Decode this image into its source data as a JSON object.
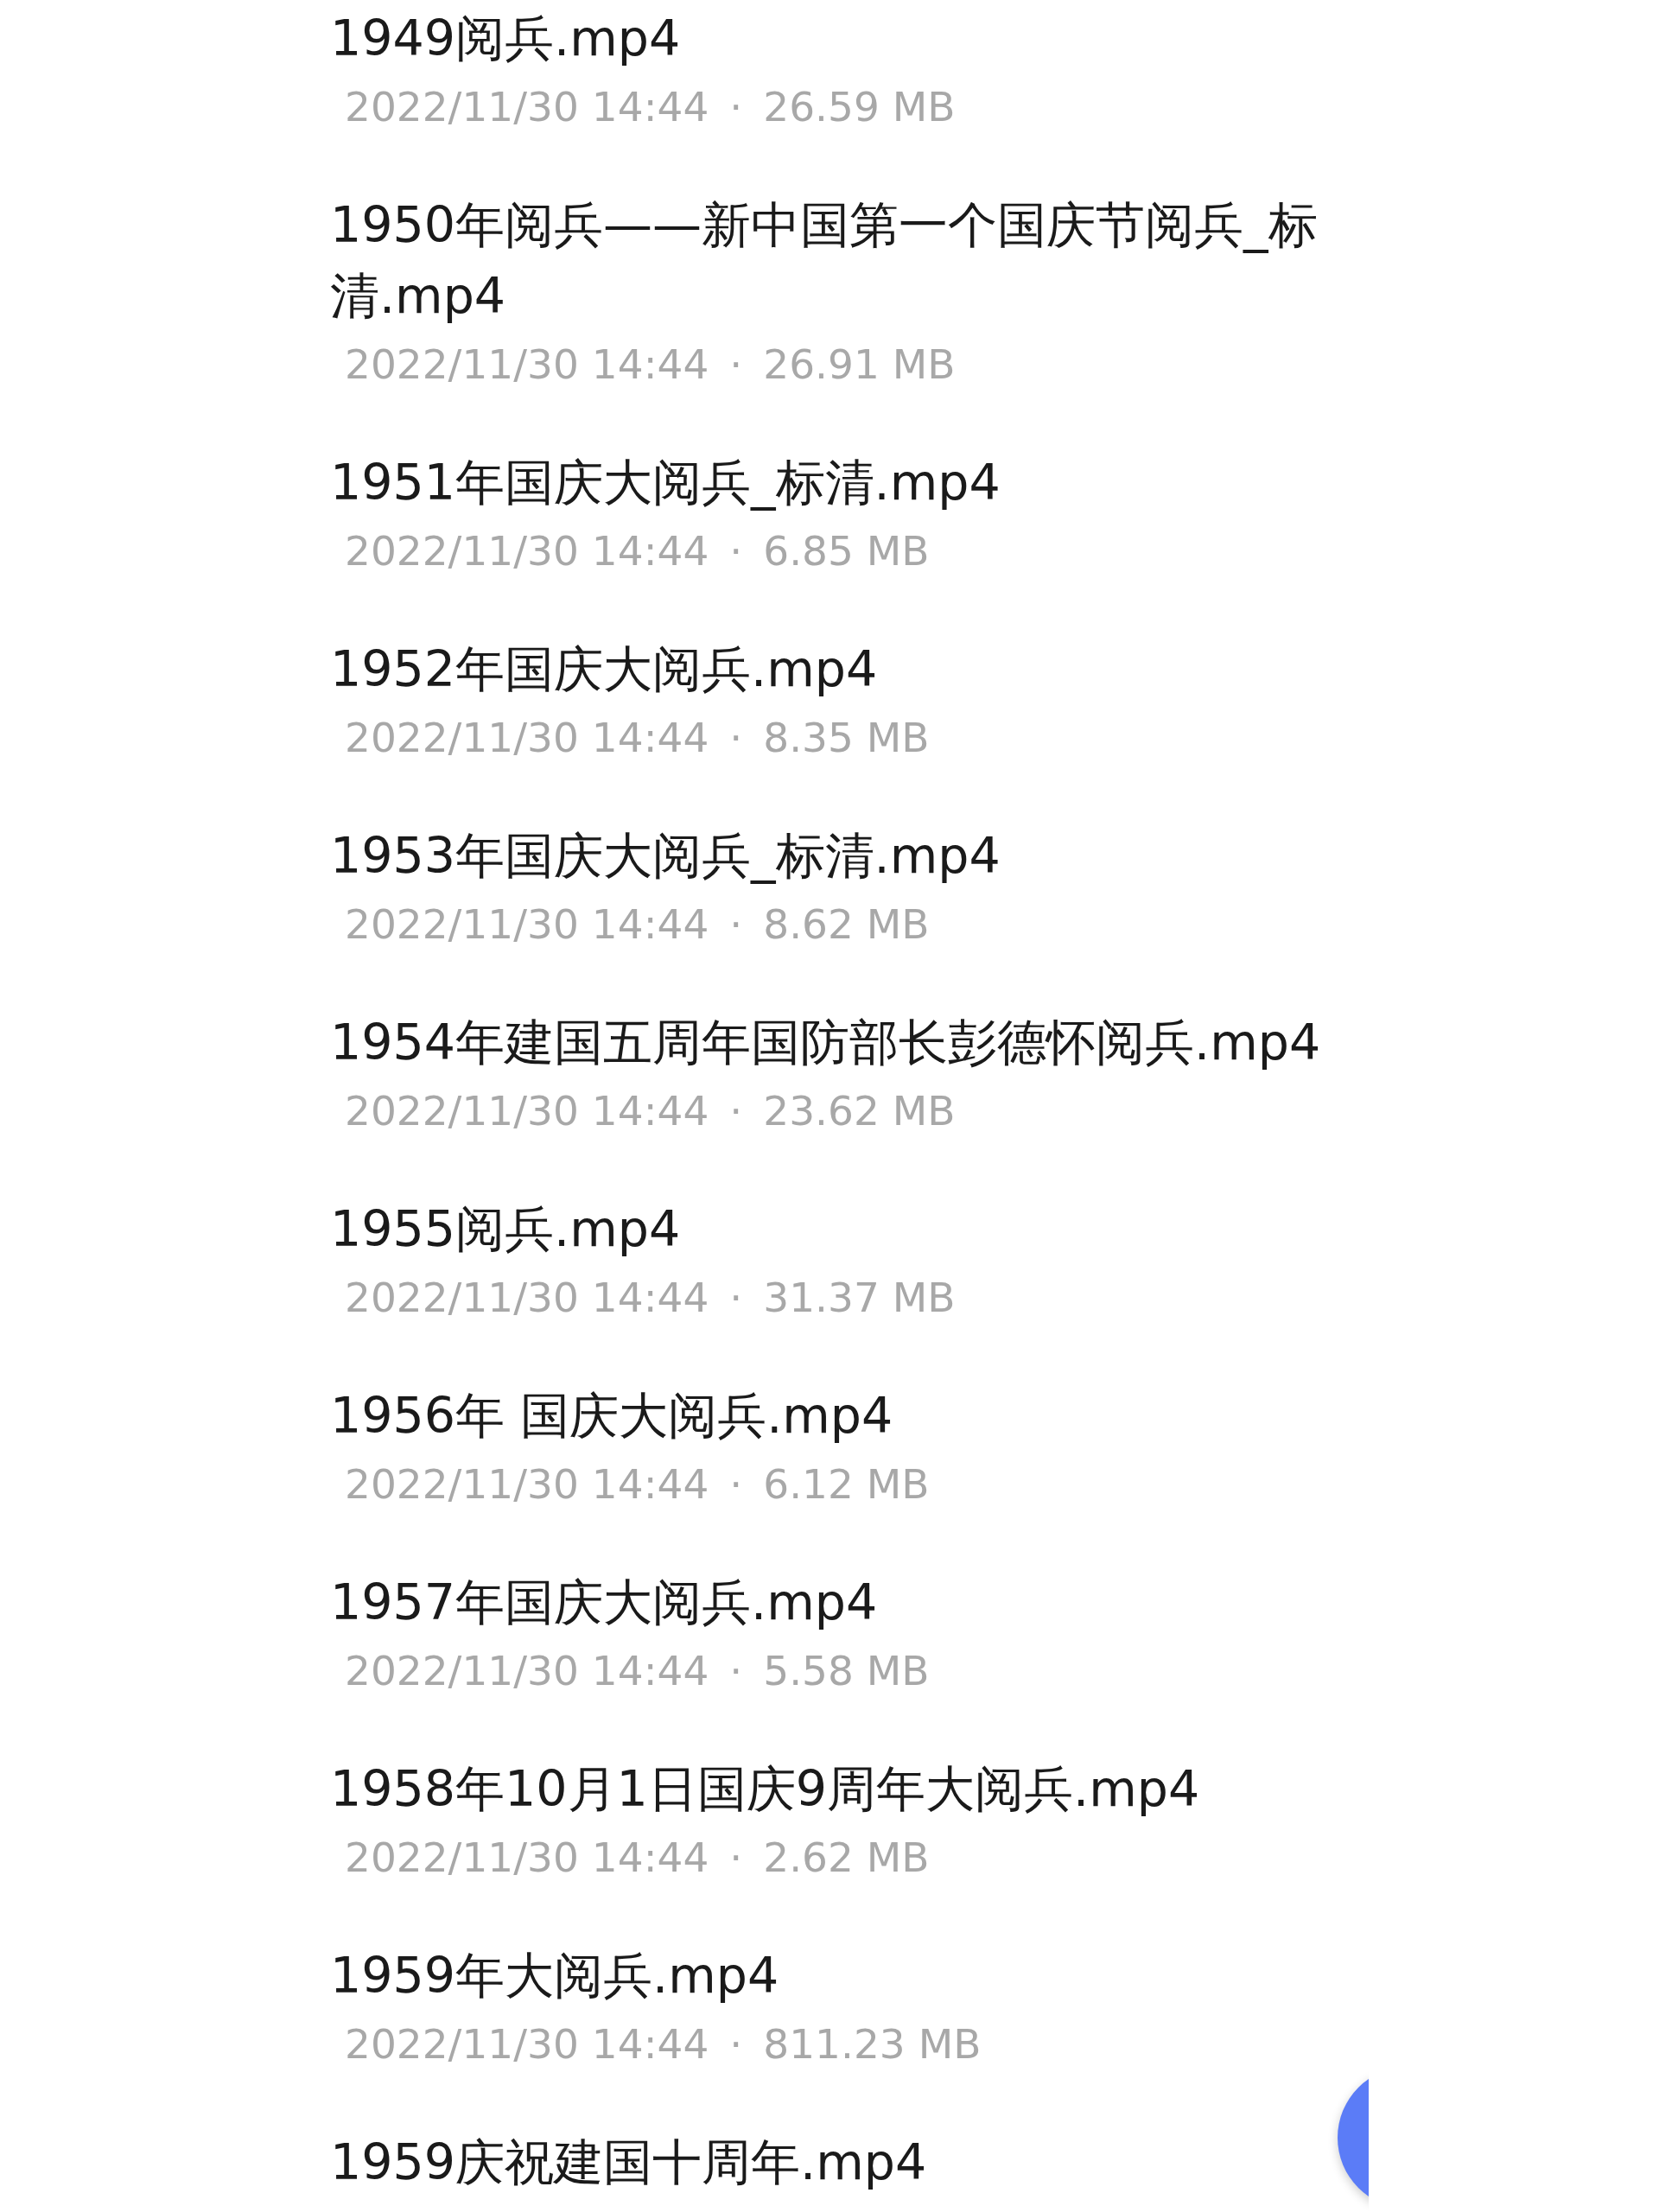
{
  "files": [
    {
      "name": "1949阅兵.mp4",
      "date": "2022/11/30 14:44",
      "separator": "·",
      "size": "26.59 MB"
    },
    {
      "name": "1950年阅兵——新中国第一个国庆节阅兵_标清.mp4",
      "date": "2022/11/30 14:44",
      "separator": "·",
      "size": "26.91 MB"
    },
    {
      "name": "1951年国庆大阅兵_标清.mp4",
      "date": "2022/11/30 14:44",
      "separator": "·",
      "size": "6.85 MB"
    },
    {
      "name": "1952年国庆大阅兵.mp4",
      "date": "2022/11/30 14:44",
      "separator": "·",
      "size": "8.35 MB"
    },
    {
      "name": "1953年国庆大阅兵_标清.mp4",
      "date": "2022/11/30 14:44",
      "separator": "·",
      "size": "8.62 MB"
    },
    {
      "name": "1954年建国五周年国防部长彭德怀阅兵.mp4",
      "date": "2022/11/30 14:44",
      "separator": "·",
      "size": "23.62 MB"
    },
    {
      "name": "1955阅兵.mp4",
      "date": "2022/11/30 14:44",
      "separator": "·",
      "size": "31.37 MB"
    },
    {
      "name": "1956年 国庆大阅兵.mp4",
      "date": "2022/11/30 14:44",
      "separator": "·",
      "size": "6.12 MB"
    },
    {
      "name": "1957年国庆大阅兵.mp4",
      "date": "2022/11/30 14:44",
      "separator": "·",
      "size": "5.58 MB"
    },
    {
      "name": "1958年10月1日国庆9周年大阅兵.mp4",
      "date": "2022/11/30 14:44",
      "separator": "·",
      "size": "2.62 MB"
    },
    {
      "name": "1959年大阅兵.mp4",
      "date": "2022/11/30 14:44",
      "separator": "·",
      "size": "811.23 MB"
    },
    {
      "name": "1959庆祝建国十周年.mp4"
    }
  ]
}
